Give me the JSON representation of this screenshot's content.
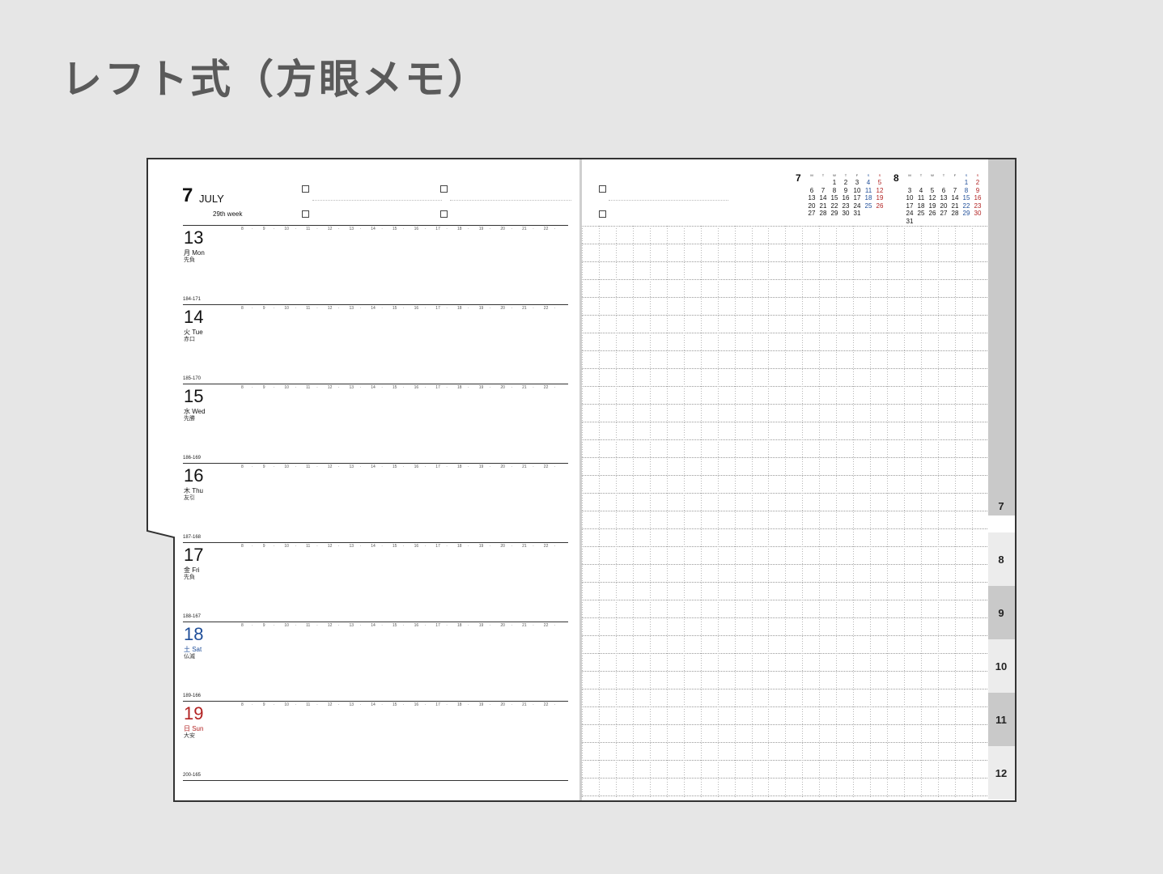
{
  "title": "レフト式（方眼メモ）",
  "colors": {
    "background": "#e6e6e6",
    "sunday": "#b22222",
    "saturday": "#1f4e99",
    "tab_gray": "#c9c9c9"
  },
  "left_page": {
    "month_number": "7",
    "month_name": "JULY",
    "week_label": "29th week",
    "hours": [
      "8",
      "9",
      "10",
      "11",
      "12",
      "13",
      "14",
      "15",
      "16",
      "17",
      "18",
      "19",
      "20",
      "21",
      "22"
    ],
    "days": [
      {
        "num": "13",
        "name": "月 Mon",
        "rokuyo": "先負",
        "count": "184-171",
        "color": "normal"
      },
      {
        "num": "14",
        "name": "火 Tue",
        "rokuyo": "赤口",
        "count": "185-170",
        "color": "normal"
      },
      {
        "num": "15",
        "name": "水 Wed",
        "rokuyo": "先勝",
        "count": "186-169",
        "color": "normal"
      },
      {
        "num": "16",
        "name": "木 Thu",
        "rokuyo": "友引",
        "count": "187-168",
        "color": "normal"
      },
      {
        "num": "17",
        "name": "金 Fri",
        "rokuyo": "先負",
        "count": "188-167",
        "color": "normal"
      },
      {
        "num": "18",
        "name": "土 Sat",
        "rokuyo": "仏滅",
        "count": "189-166",
        "color": "blue"
      },
      {
        "num": "19",
        "name": "日 Sun",
        "rokuyo": "大安",
        "count": "200-165",
        "color": "red"
      }
    ]
  },
  "mini_calendars": [
    {
      "month": "7",
      "headers": [
        "M",
        "T",
        "W",
        "T",
        "F",
        "S",
        "S"
      ],
      "weeks": [
        [
          "",
          "",
          "1",
          "2",
          "3",
          "4",
          "5"
        ],
        [
          "6",
          "7",
          "8",
          "9",
          "10",
          "11",
          "12"
        ],
        [
          "13",
          "14",
          "15",
          "16",
          "17",
          "18",
          "19"
        ],
        [
          "20",
          "21",
          "22",
          "23",
          "24",
          "25",
          "26"
        ],
        [
          "27",
          "28",
          "29",
          "30",
          "31",
          "",
          ""
        ]
      ]
    },
    {
      "month": "8",
      "headers": [
        "M",
        "T",
        "W",
        "T",
        "F",
        "S",
        "S"
      ],
      "weeks": [
        [
          "",
          "",
          "",
          "",
          "",
          "1",
          "2"
        ],
        [
          "3",
          "4",
          "5",
          "6",
          "7",
          "8",
          "9"
        ],
        [
          "10",
          "11",
          "12",
          "13",
          "14",
          "15",
          "16"
        ],
        [
          "17",
          "18",
          "19",
          "20",
          "21",
          "22",
          "23"
        ],
        [
          "24",
          "25",
          "26",
          "27",
          "28",
          "29",
          "30"
        ],
        [
          "31",
          "",
          "",
          "",
          "",
          "",
          ""
        ]
      ]
    }
  ],
  "month_tabs": [
    {
      "label": "7",
      "shade": "gray"
    },
    {
      "label": "8",
      "shade": "light"
    },
    {
      "label": "9",
      "shade": "gray"
    },
    {
      "label": "10",
      "shade": "light"
    },
    {
      "label": "11",
      "shade": "gray"
    },
    {
      "label": "12",
      "shade": "light"
    }
  ]
}
